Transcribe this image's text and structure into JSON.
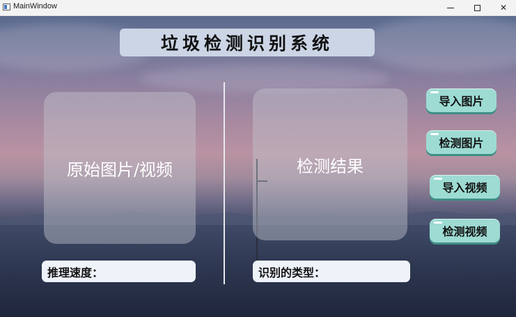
{
  "window": {
    "title": "MainWindow",
    "controls": {
      "minimize": "minimize",
      "maximize": "maximize",
      "close": "✕"
    }
  },
  "header": {
    "title": "垃圾检测识别系统"
  },
  "panels": {
    "original": "原始图片/视频",
    "result": "检测结果"
  },
  "info": {
    "inference_speed": "推理速度：",
    "detected_type": "识别的类型："
  },
  "buttons": [
    {
      "label": "导入图片"
    },
    {
      "label": "检测图片"
    },
    {
      "label": "导入视频"
    },
    {
      "label": "检测视频"
    }
  ],
  "colors": {
    "button_bg": "#9ddbd3",
    "header_bg": "#cbd5e5",
    "info_bg": "#eef2f9"
  }
}
